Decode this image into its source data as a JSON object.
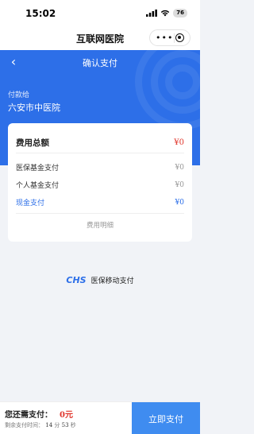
{
  "status_bar": {
    "time": "15:02",
    "battery": "76"
  },
  "mini_program": {
    "title": "互联网医院"
  },
  "nav": {
    "title": "确认支付"
  },
  "payee": {
    "label": "付款给",
    "name": "六安市中医院"
  },
  "card": {
    "total": {
      "label": "费用总额",
      "value": "¥0"
    },
    "items": [
      {
        "label": "医保基金支付",
        "value": "¥0"
      },
      {
        "label": "个人基金支付",
        "value": "¥0"
      },
      {
        "label": "现金支付",
        "value": "¥0"
      }
    ],
    "detail_link": "费用明细"
  },
  "chs": {
    "logo": "CHS",
    "text": "医保移动支付"
  },
  "bottom": {
    "need_label": "您还需支付：",
    "need_amount": "0元",
    "remain_label": "剩余支付时间：",
    "remain_minutes": "14",
    "remain_min_unit": "分",
    "remain_seconds": "53",
    "remain_sec_unit": "秒",
    "pay_button": "立即支付"
  },
  "colors": {
    "primary": "#2d6fe8",
    "button": "#3f8cf0",
    "amount": "#e0352b"
  },
  "icons": [
    "back-arrow-icon",
    "signal-icon",
    "wifi-icon",
    "more-dots-icon",
    "close-target-icon"
  ]
}
